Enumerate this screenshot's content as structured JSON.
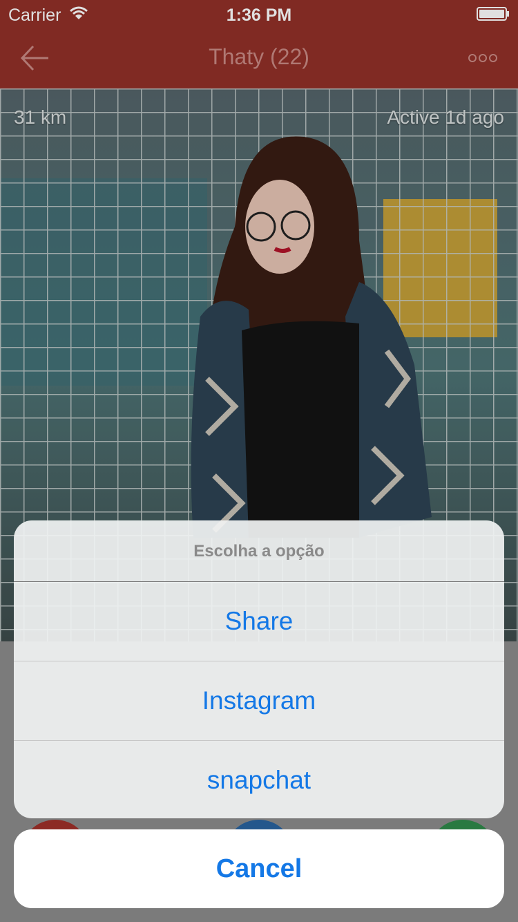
{
  "status_bar": {
    "carrier": "Carrier",
    "time": "1:36 PM"
  },
  "nav": {
    "title": "Thaty (22)",
    "back_icon": "back-arrow-icon",
    "more_icon": "more-dots-icon"
  },
  "photo": {
    "distance": "31 km",
    "last_active": "Active 1d ago"
  },
  "action_sheet": {
    "title": "Escolha a opção",
    "options": [
      "Share",
      "Instagram",
      "snapchat"
    ],
    "cancel": "Cancel"
  },
  "colors": {
    "brand": "#923028",
    "action_blue": "#1478e6"
  }
}
